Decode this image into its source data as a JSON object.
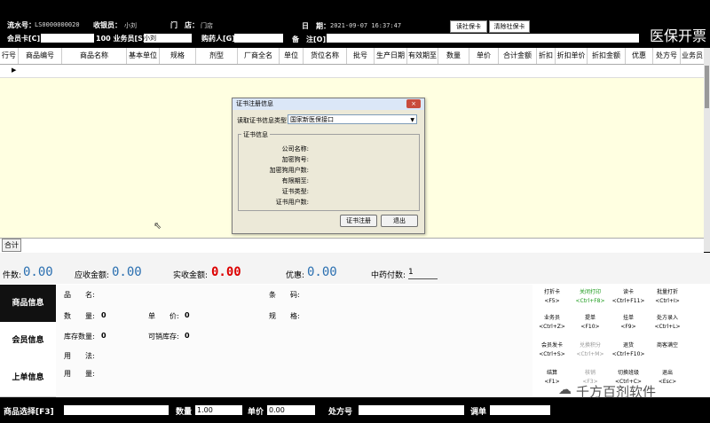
{
  "header": {
    "serial_label": "流水号：",
    "serial_value": "LS0000000020",
    "cashier_label": "收银员：",
    "cashier_value": "小刘",
    "store_label": "门　店：",
    "store_value": "门店",
    "date_label": "日　期：",
    "date_value": "2021-09-07 16:37:47",
    "read_card_btn": "读社保卡",
    "clear_card_btn": "清除社保卡",
    "member_card_label": "会员卡[C]",
    "salesman_label": "100 业务员[S]",
    "salesman_value": "小刘",
    "buyer_label": "购药人[G]",
    "note_label": "备　注[O]",
    "brand": "医保开票"
  },
  "grid": {
    "columns": [
      "行号",
      "商品编号",
      "商品名称",
      "基本单位",
      "规格",
      "剂型",
      "厂商全名",
      "单位",
      "货位名称",
      "批号",
      "生产日期",
      "有效期至",
      "数量",
      "单价",
      "合计金额",
      "折扣",
      "折扣单价",
      "折扣金额",
      "优惠",
      "处方号",
      "业务员"
    ],
    "total_label": "合计"
  },
  "summary": {
    "count_label": "件数:",
    "count_value": "0.00",
    "receivable_label": "应收金额:",
    "receivable_value": "0.00",
    "received_label": "实收金额:",
    "received_value": "0.00",
    "discount_label": "优惠:",
    "discount_value": "0.00",
    "herb_label": "中药付数:",
    "herb_value": "1"
  },
  "side_tabs": [
    "商品信息",
    "会员信息",
    "上单信息"
  ],
  "product_info": {
    "name_label": "品　　名:",
    "barcode_label": "条　　码:",
    "qty_label": "数　　量:",
    "qty_value": "0",
    "price_label": "单　　价:",
    "price_value": "0",
    "spec_label": "规　　格:",
    "stock_label": "库存数量:",
    "stock_value": "0",
    "sellable_label": "可销库存:",
    "sellable_value": "0",
    "usage_label": "用　　法:",
    "dosage_label": "用　　量:"
  },
  "function_buttons": [
    {
      "name": "打折卡",
      "key": "<F5>",
      "style": "normal"
    },
    {
      "name": "关闭打印",
      "key": "<Ctrl+F8>",
      "style": "green"
    },
    {
      "name": "读卡",
      "key": "<Ctrl+F11>",
      "style": "normal"
    },
    {
      "name": "批量打折",
      "key": "<Ctrl+I>",
      "style": "normal"
    },
    {
      "name": "业务员",
      "key": "<Ctrl+Z>",
      "style": "normal"
    },
    {
      "name": "提单",
      "key": "<F10>",
      "style": "normal"
    },
    {
      "name": "挂单",
      "key": "<F9>",
      "style": "normal"
    },
    {
      "name": "处方录入",
      "key": "<Ctrl+L>",
      "style": "normal"
    },
    {
      "name": "会员发卡",
      "key": "<Ctrl+S>",
      "style": "normal"
    },
    {
      "name": "兑换积分",
      "key": "<Ctrl+M>",
      "style": "gray"
    },
    {
      "name": "退货",
      "key": "<Ctrl+F10>",
      "style": "normal"
    },
    {
      "name": "商客满空",
      "key": "",
      "style": "normal"
    },
    {
      "name": "结算",
      "key": "<F1>",
      "style": "normal"
    },
    {
      "name": "核销",
      "key": "<F3>",
      "style": "gray"
    },
    {
      "name": "切换班级",
      "key": "<Ctrl+C>",
      "style": "normal"
    },
    {
      "name": "退出",
      "key": "<Esc>",
      "style": "normal"
    }
  ],
  "footer": {
    "product_select_label": "商品选择[F3]",
    "quantity_label": "数量",
    "quantity_value": "1.00",
    "unit_price_label": "单价",
    "unit_price_value": "0.00",
    "prescription_label": "处方号",
    "order_label": "调单"
  },
  "dialog": {
    "title": "证书注册信息",
    "close": "×",
    "read_type_label": "读取证书信息类型",
    "read_type_value": "国家新医保接口",
    "group_title": "证书信息",
    "rows": [
      "公司名称:",
      "加密狗号:",
      "加密狗用户数:",
      "有限期至:",
      "证书类型:",
      "证书用户数:"
    ],
    "register_btn": "证书注册",
    "exit_btn": "退出"
  },
  "watermark": "千方百剂软件"
}
